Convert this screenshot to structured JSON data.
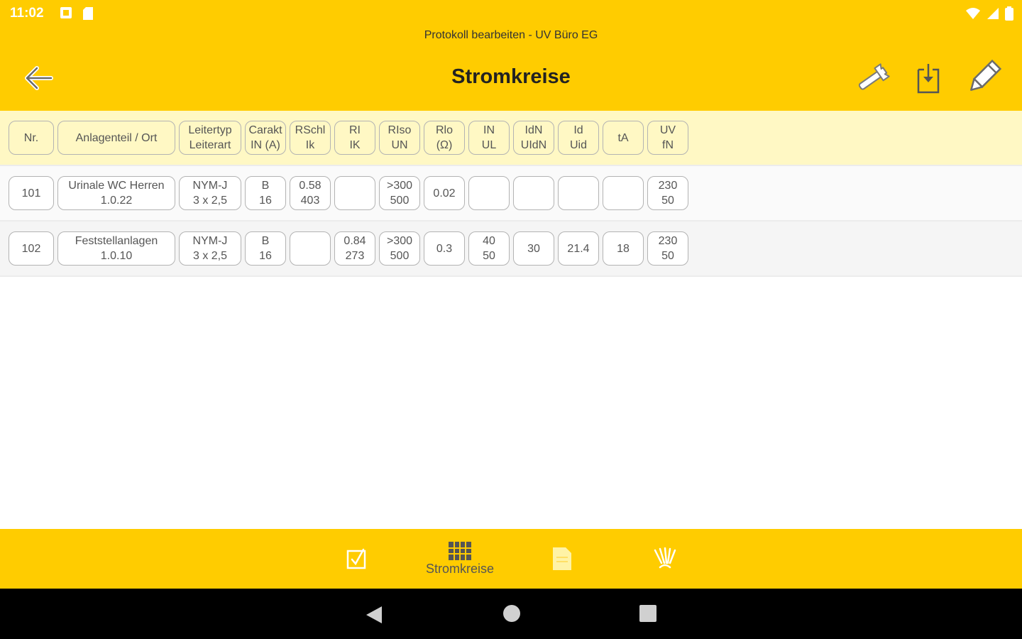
{
  "status_bar": {
    "time": "11:02"
  },
  "header": {
    "subtitle": "Protokoll bearbeiten - UV Büro EG",
    "title": "Stromkreise"
  },
  "table": {
    "columns": [
      {
        "line1": "Nr.",
        "line2": ""
      },
      {
        "line1": "Anlagenteil / Ort",
        "line2": ""
      },
      {
        "line1": "Leitertyp",
        "line2": "Leiterart"
      },
      {
        "line1": "Carakt",
        "line2": "IN (A)"
      },
      {
        "line1": "RSchl",
        "line2": "Ik"
      },
      {
        "line1": "RI",
        "line2": "IK"
      },
      {
        "line1": "RIso",
        "line2": "UN"
      },
      {
        "line1": "Rlo",
        "line2": "(Ω)"
      },
      {
        "line1": "IN",
        "line2": "UL"
      },
      {
        "line1": "IdN",
        "line2": "UIdN"
      },
      {
        "line1": "Id",
        "line2": "Uid"
      },
      {
        "line1": "tA",
        "line2": ""
      },
      {
        "line1": "UV",
        "line2": "fN"
      }
    ],
    "rows": [
      [
        {
          "line1": "101",
          "line2": ""
        },
        {
          "line1": "Urinale WC Herren",
          "line2": "1.0.22"
        },
        {
          "line1": "NYM-J",
          "line2": "3 x 2,5"
        },
        {
          "line1": "B",
          "line2": "16"
        },
        {
          "line1": "0.58",
          "line2": "403"
        },
        {
          "line1": "",
          "line2": ""
        },
        {
          "line1": ">300",
          "line2": "500"
        },
        {
          "line1": "0.02",
          "line2": ""
        },
        {
          "line1": "",
          "line2": ""
        },
        {
          "line1": "",
          "line2": ""
        },
        {
          "line1": "",
          "line2": ""
        },
        {
          "line1": "",
          "line2": ""
        },
        {
          "line1": "230",
          "line2": "50"
        }
      ],
      [
        {
          "line1": "102",
          "line2": ""
        },
        {
          "line1": "Feststellanlagen",
          "line2": "1.0.10"
        },
        {
          "line1": "NYM-J",
          "line2": "3 x 2,5"
        },
        {
          "line1": "B",
          "line2": "16"
        },
        {
          "line1": "",
          "line2": ""
        },
        {
          "line1": "0.84",
          "line2": "273"
        },
        {
          "line1": ">300",
          "line2": "500"
        },
        {
          "line1": "0.3",
          "line2": ""
        },
        {
          "line1": "40",
          "line2": "50"
        },
        {
          "line1": "30",
          "line2": ""
        },
        {
          "line1": "21.4",
          "line2": ""
        },
        {
          "line1": "18",
          "line2": ""
        },
        {
          "line1": "230",
          "line2": "50"
        }
      ]
    ]
  },
  "bottom_nav": {
    "items": [
      {
        "icon": "checkbox-icon",
        "label": ""
      },
      {
        "icon": "grid-table-icon",
        "label": "Stromkreise"
      },
      {
        "icon": "document-icon",
        "label": ""
      },
      {
        "icon": "signature-icon",
        "label": ""
      }
    ]
  },
  "colors": {
    "accent": "#ffcc00",
    "header_row": "#fff8c4",
    "border": "#b3b3b3",
    "text": "#555555"
  }
}
